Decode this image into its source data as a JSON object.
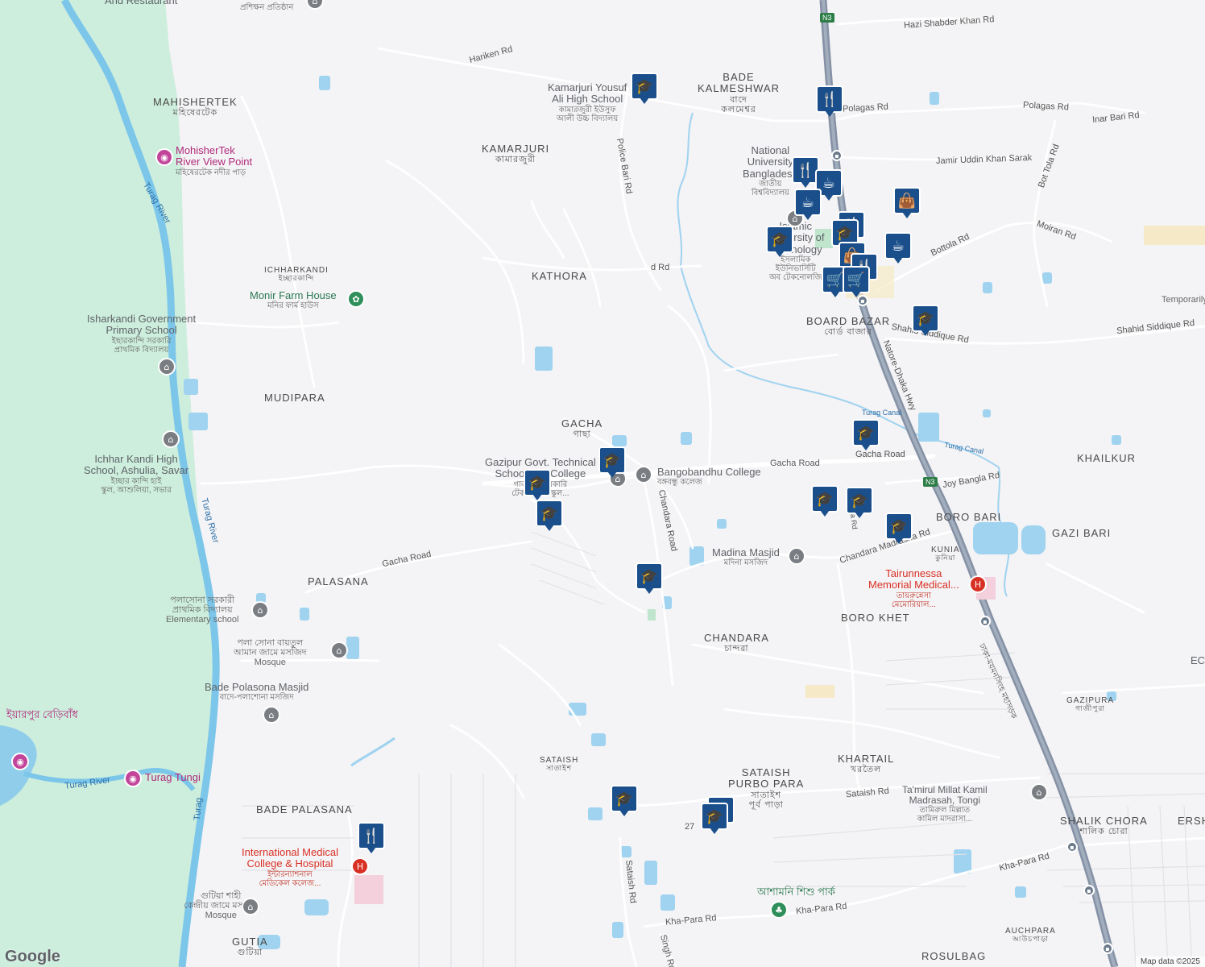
{
  "map": {
    "attribution": "Map data ©2025",
    "logo": "Google",
    "colors": {
      "land": "#f4f3f5",
      "park": "#cdeedd",
      "water": "#9fd3f0",
      "river": "#7cc6ea",
      "highway": "#8592a6",
      "road": "#ffffff",
      "marker": "#1a4f8b"
    },
    "areas": [
      {
        "id": "mahishertek",
        "name": "MAHISHERTEK",
        "sub": "মহিষেরটেক"
      },
      {
        "id": "kamarjuri",
        "name": "KAMARJURI",
        "sub": "কামারজুরী"
      },
      {
        "id": "bade-kalmeshwar",
        "name": "BADE\nKALMESHWAR",
        "sub": "বাদে\nকলমেশ্বর"
      },
      {
        "id": "ichharkandi",
        "name": "ICHHARKANDI",
        "sub": "ইচ্ছারকান্দি"
      },
      {
        "id": "kathora",
        "name": "KATHORA",
        "sub": ""
      },
      {
        "id": "mudipara",
        "name": "MUDIPARA",
        "sub": ""
      },
      {
        "id": "gacha",
        "name": "GACHA",
        "sub": "গাছা"
      },
      {
        "id": "board-bazar",
        "name": "BOARD BAZAR",
        "sub": "বোর্ড বাজার"
      },
      {
        "id": "khailkur",
        "name": "KHAILKUR",
        "sub": ""
      },
      {
        "id": "boro-bari",
        "name": "BORO BARI",
        "sub": ""
      },
      {
        "id": "gazi-bari",
        "name": "GAZI BARI",
        "sub": ""
      },
      {
        "id": "kunia",
        "name": "KUNIA",
        "sub": "কুনিয়া"
      },
      {
        "id": "palasana",
        "name": "PALASANA",
        "sub": ""
      },
      {
        "id": "boro-khet",
        "name": "BORO KHET",
        "sub": ""
      },
      {
        "id": "chandara",
        "name": "CHANDARA",
        "sub": "চান্দরা"
      },
      {
        "id": "gazipura",
        "name": "GAZIPURA",
        "sub": "গাজীপুরা"
      },
      {
        "id": "sataish",
        "name": "SATAISH",
        "sub": "সাতাইশ"
      },
      {
        "id": "sataish-purbo-para",
        "name": "SATAISH\nPURBO PARA",
        "sub": "সাতাইশ\nপূর্ব পাড়া"
      },
      {
        "id": "khartail",
        "name": "KHARTAIL",
        "sub": "খরতৈল"
      },
      {
        "id": "bade-palasana",
        "name": "BADE PALASANA",
        "sub": ""
      },
      {
        "id": "shalik-chora",
        "name": "SHALIK CHORA",
        "sub": "শালিক চোরা"
      },
      {
        "id": "ersh",
        "name": "ERSH",
        "sub": ""
      },
      {
        "id": "gutia",
        "name": "GUTIA",
        "sub": "গুটিয়া"
      },
      {
        "id": "auchpara",
        "name": "AUCHPARA",
        "sub": "আউচপাড়া"
      },
      {
        "id": "rosulbag",
        "name": "ROSULBAG",
        "sub": ""
      }
    ],
    "pois": [
      {
        "id": "and-restaurant",
        "name": "And Restaurant",
        "sub": ""
      },
      {
        "id": "prashikkhan",
        "name": "",
        "sub": "প্রশিক্ষন প্রতিষ্ঠান"
      },
      {
        "id": "kamarjuri-school",
        "name": "Kamarjuri Yousuf\nAli High School",
        "sub": "কামারজুরী ইউসুফ\nআলী উচ্চ বিদ্যালয়"
      },
      {
        "id": "mohishertek-view",
        "name": "MohisherTek\nRiver View Point",
        "sub": "মহিষেরটেক নদীর পাড়"
      },
      {
        "id": "national-university",
        "name": "National\nUniversity\nBangladesh",
        "sub": "জাতীয়\nবিশ্ববিদ্যালয়"
      },
      {
        "id": "islamic-university",
        "name": "Islamic\nUniversity of\nTechnology",
        "sub": "ইসলামিক\nইউনিভার্সিটি\nঅব টেকনোলজি"
      },
      {
        "id": "monir-farm",
        "name": "Monir Farm House",
        "sub": "মনির ফার্ম হাউস"
      },
      {
        "id": "isharkandi-school",
        "name": "Isharkandi Government\nPrimary School",
        "sub": "ইছারকান্দি সরকারি\nপ্রাথমিক বিদ্যালয়"
      },
      {
        "id": "ichhar-kandi-high",
        "name": "Ichhar Kandi High\nSchool, Ashulia, Savar",
        "sub": "ইচ্ছার কান্দি হাই\nস্কুল, আশুলিয়া, সভার"
      },
      {
        "id": "gazipur-tech",
        "name": "Gazipur Govt. Technical\nSchool and College",
        "sub": "গাজীপুর সরকারি\nটেকনিক্যাল স্কুল..."
      },
      {
        "id": "bangobandhu-college",
        "name": "Bangobandhu College",
        "sub": "বঙ্গবন্ধু কলেজ"
      },
      {
        "id": "madina-masjid",
        "name": "Madina Masjid",
        "sub": "মদিনা মসজিদ"
      },
      {
        "id": "tairunnessa",
        "name": "Tairunnessa\nMemorial Medical...",
        "sub": "তায়রুন্নেসা\nমেমোরিয়াল..."
      },
      {
        "id": "palasona-school",
        "name": "",
        "sub": "পলাসোনা সরকারী\nপ্রাথমিক বিদ্যালয়\nElementary school"
      },
      {
        "id": "palasona-mosque",
        "name": "",
        "sub": "পলা সোনা বায়তুল\nআমান জামে মসজিদ\nMosque"
      },
      {
        "id": "bade-polasona-masjid",
        "name": "Bade Polasona Masjid",
        "sub": "বাদে-পলাশোনা মসজিদ"
      },
      {
        "id": "iyarpur",
        "name": "ইয়ারপুর বেড়িবাঁধ",
        "sub": ""
      },
      {
        "id": "turag-tungi",
        "name": "Turag Tungi",
        "sub": ""
      },
      {
        "id": "international-medical",
        "name": "International Medical\nCollege & Hospital",
        "sub": "ইন্টারন্যাশনাল\nমেডিকেল কলেজ..."
      },
      {
        "id": "gutia-mosque",
        "name": "",
        "sub": "গুটিয়া শাহী\nকেন্দ্রীয় জামে মসজিদ\nMosque"
      },
      {
        "id": "tamirul-millat",
        "name": "Ta'mirul Millat Kamil\nMadrasah, Tongi",
        "sub": "তামিরুল মিল্লাত\nকামিল মাদরাসা..."
      },
      {
        "id": "ashmani-park",
        "name": "আশামনি শিশু পার্ক",
        "sub": ""
      },
      {
        "id": "temporary",
        "name": "Temporarily",
        "sub": ""
      },
      {
        "id": "ec",
        "name": "EC",
        "sub": ""
      }
    ],
    "roads": [
      {
        "id": "hariken-rd",
        "name": "Hariken Rd"
      },
      {
        "id": "hazi-shabder",
        "name": "Hazi Shabder Khan Rd"
      },
      {
        "id": "polagas-rd-1",
        "name": "Polagas Rd"
      },
      {
        "id": "polagas-rd-2",
        "name": "Polagas Rd"
      },
      {
        "id": "inar-bari",
        "name": "Inar Bari Rd"
      },
      {
        "id": "jamir-uddin",
        "name": "Jamir Uddin Khan Sarak"
      },
      {
        "id": "bot-tola",
        "name": "Bot Tola Rd"
      },
      {
        "id": "moiran",
        "name": "Moiran Rd"
      },
      {
        "id": "bottola-rd",
        "name": "Bottola Rd"
      },
      {
        "id": "police-bari",
        "name": "Police Bari Rd"
      },
      {
        "id": "vd-rd",
        "name": "d Rd"
      },
      {
        "id": "shahid-siddique-1",
        "name": "Shahid Siddique Rd"
      },
      {
        "id": "shahid-siddique-2",
        "name": "Shahid Siddique Rd"
      },
      {
        "id": "natore-dhaka",
        "name": "Natore-Dhaka Hwy"
      },
      {
        "id": "turag-canal-1",
        "name": "Turag Canal"
      },
      {
        "id": "turag-canal-2",
        "name": "Turag Canal"
      },
      {
        "id": "gacha-road-1",
        "name": "Gacha Road"
      },
      {
        "id": "gacha-road-2",
        "name": "Gacha Road"
      },
      {
        "id": "gacha-road-3",
        "name": "Gacha Road"
      },
      {
        "id": "joy-bangla",
        "name": "Joy Bangla Rd"
      },
      {
        "id": "chandara-road",
        "name": "Chandara Road"
      },
      {
        "id": "chandara-madrasha",
        "name": "Chandara Madrasha Rd"
      },
      {
        "id": "mirza-rd",
        "name": "Mirza Rd"
      },
      {
        "id": "sataish-rd",
        "name": "Sataish Rd"
      },
      {
        "id": "sataish-rd-v",
        "name": "Sataish Rd"
      },
      {
        "id": "rd-27",
        "name": "27"
      },
      {
        "id": "kha-para-1",
        "name": "Kha-Para Rd"
      },
      {
        "id": "kha-para-2",
        "name": "Kha-Para Rd"
      },
      {
        "id": "kha-para-3",
        "name": "Kha-Para Rd"
      },
      {
        "id": "singh-rd",
        "name": "Singh Rd"
      },
      {
        "id": "dhaka-mymensingh",
        "name": "ঢাকা-ময়মনসিংহ মহাসড়ক"
      },
      {
        "id": "turag-river-1",
        "name": "Turag River"
      },
      {
        "id": "turag-river-2",
        "name": "Turag River"
      },
      {
        "id": "turag-river-3",
        "name": "Turag River"
      },
      {
        "id": "turag-vertical",
        "name": "Turag"
      },
      {
        "id": "n3-top",
        "name": "N3"
      },
      {
        "id": "n3-mid",
        "name": "N3"
      }
    ]
  }
}
